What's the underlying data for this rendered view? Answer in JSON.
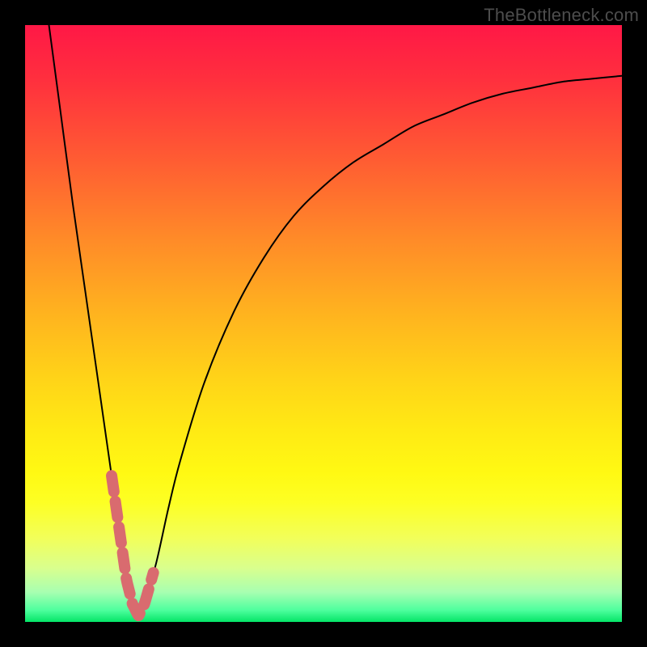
{
  "watermark": "TheBottleneck.com",
  "colors": {
    "frame": "#000000",
    "curve": "#000000",
    "valley_marker": "#d96b6f",
    "gradient_top": "#ff1846",
    "gradient_bottom": "#04e567"
  },
  "chart_data": {
    "type": "line",
    "title": "",
    "xlabel": "",
    "ylabel": "",
    "xlim": [
      0,
      100
    ],
    "ylim": [
      0,
      100
    ],
    "background": "vertical-gradient red→orange→yellow→green",
    "description": "V-shaped bottleneck curve: steep descent from upper-left to a minimum near x≈17, then a concave-down rise asymptotically flattening toward the right edge. The valley bottom is highlighted with pink dashed segments.",
    "x": [
      4,
      6,
      8,
      10,
      12,
      14,
      15,
      16,
      17,
      18,
      19,
      20,
      22,
      24,
      26,
      30,
      35,
      40,
      45,
      50,
      55,
      60,
      65,
      70,
      75,
      80,
      85,
      90,
      95,
      100
    ],
    "values": [
      100,
      85,
      70,
      56,
      42,
      28,
      21,
      14,
      7,
      3,
      1,
      3,
      10,
      19,
      27,
      40,
      52,
      61,
      68,
      73,
      77,
      80,
      83,
      85,
      87,
      88.5,
      89.5,
      90.5,
      91,
      91.5
    ],
    "valley_highlight_x_range": [
      14.5,
      21.5
    ]
  }
}
